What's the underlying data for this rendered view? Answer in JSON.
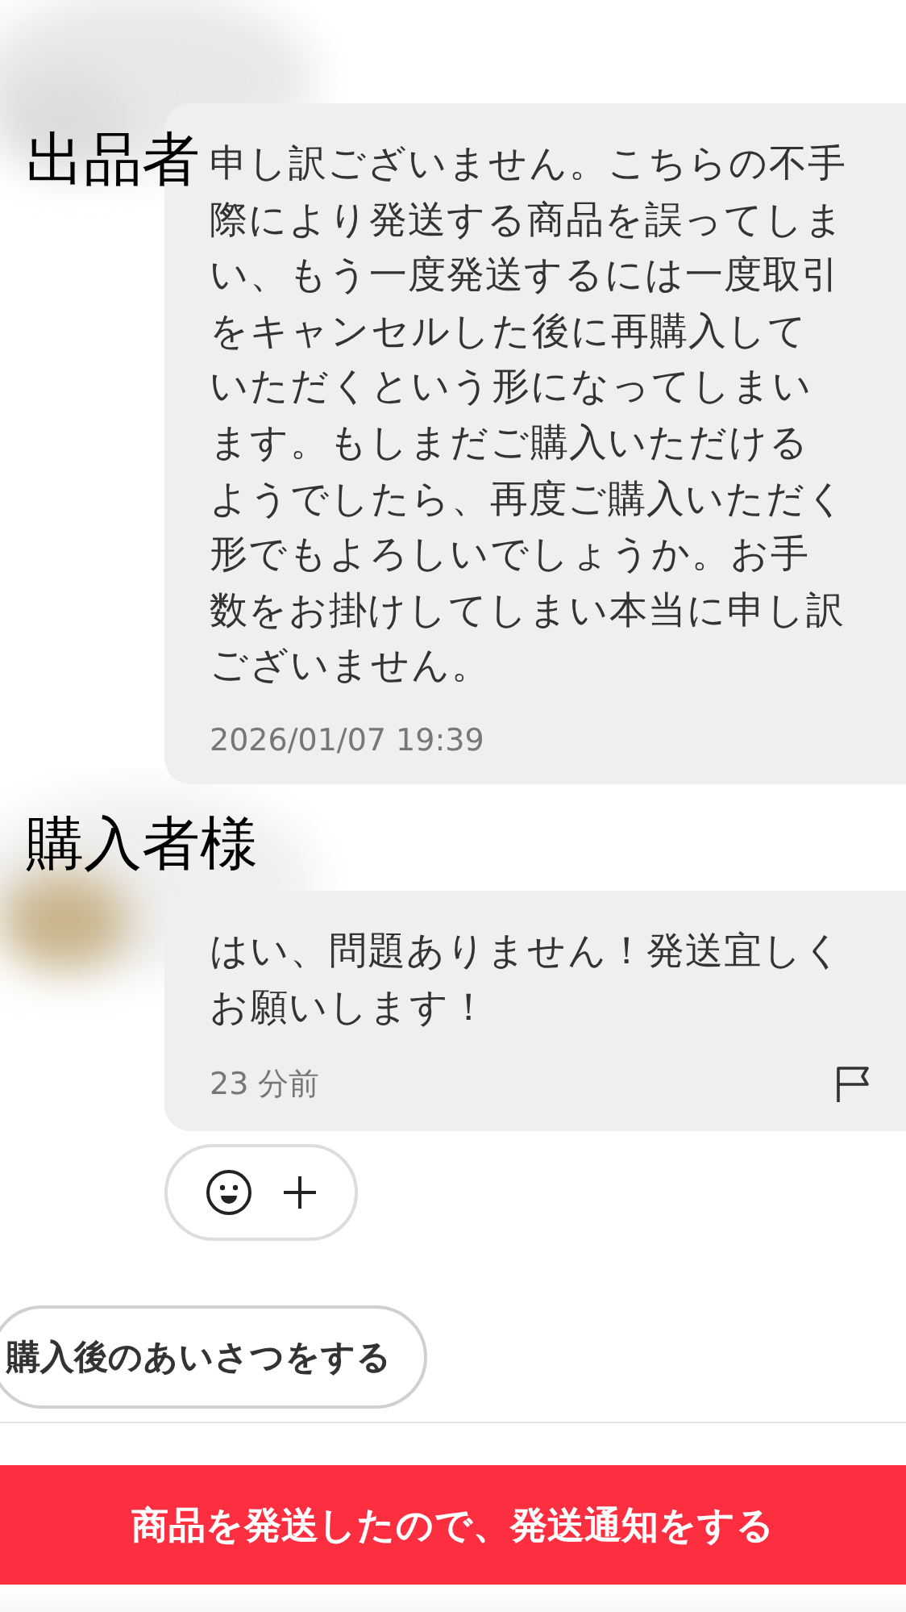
{
  "messages": [
    {
      "sender": "出品者",
      "text": "申し訳ございません。こちらの不手際により発送する商品を誤ってしまい、もう一度発送するには一度取引をキャンセルした後に再購入していただくという形になってしまいます。もしまだご購入いただけるようでしたら、再度ご購入いただく形でもよろしいでしょうか。お手数をお掛けしてしまい本当に申し訳ございません。",
      "time": "2026/01/07 19:39",
      "flag": false
    },
    {
      "sender": "購入者様",
      "text": "はい、問題ありません！発送宜しくお願いします！",
      "time": "23 分前",
      "flag": true
    }
  ],
  "greeting_button": {
    "label": "購入後のあいさつをする"
  },
  "ship_button": {
    "label": "商品を発送したので、発送通知をする"
  }
}
